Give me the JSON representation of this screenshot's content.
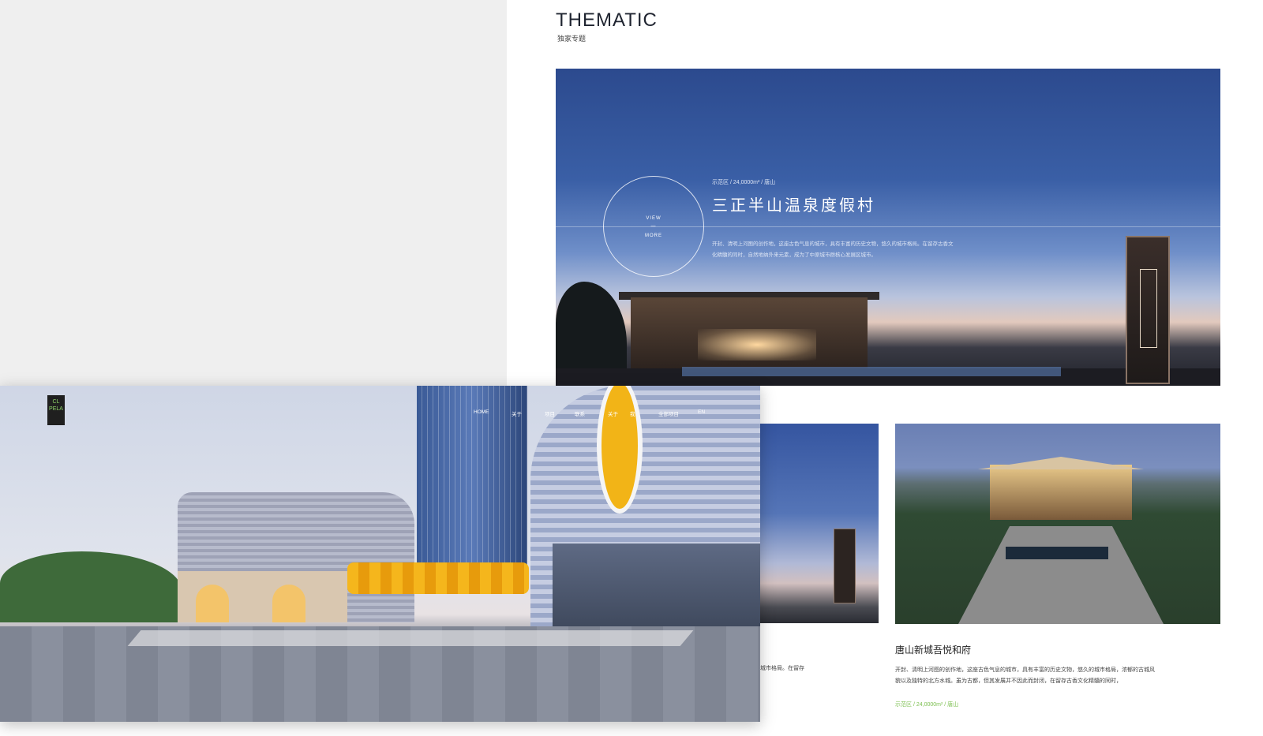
{
  "section": {
    "title": "THEMATIC",
    "subtitle": "独家专题"
  },
  "hero": {
    "view_top": "VIEW",
    "view_dash": "—",
    "view_bottom": "MORE",
    "meta": "示范区 / 24,0000m² / 唐山",
    "title": "三正半山温泉度假村",
    "desc": "开封、清明上河图的创作地，这座古色气息的城市，具有丰富的历史文物，悠久的城市格局。在留存古香文化精髓的同时，自然地纳外来元素，成为了中原城市群核心发展区城市。"
  },
  "card_left": {
    "desc_fragment": "城市格局。在留存"
  },
  "card2": {
    "title": "唐山新城吾悦和府",
    "desc": "开封、清明上河图的创作地，这座古色气息的城市，具有丰富的历史文物，悠久的城市格局，浓郁的古城风貌以及独特的北方水城。虽为古都，但其发展并不因此而封闭，在留存古香文化精髓的同时，",
    "meta": "示范区 / 24,0000m² / 唐山"
  },
  "overlay": {
    "logo_top": "CL",
    "logo_bottom": "PELA",
    "nav": [
      "HOME",
      "关于",
      "项目",
      "联系",
      "关于",
      "我",
      "全部项目",
      "EN"
    ]
  },
  "colors": {
    "hero_blue": "#2c4a8e",
    "accent_green": "#7bbf4f",
    "left_bg": "#efefef"
  }
}
